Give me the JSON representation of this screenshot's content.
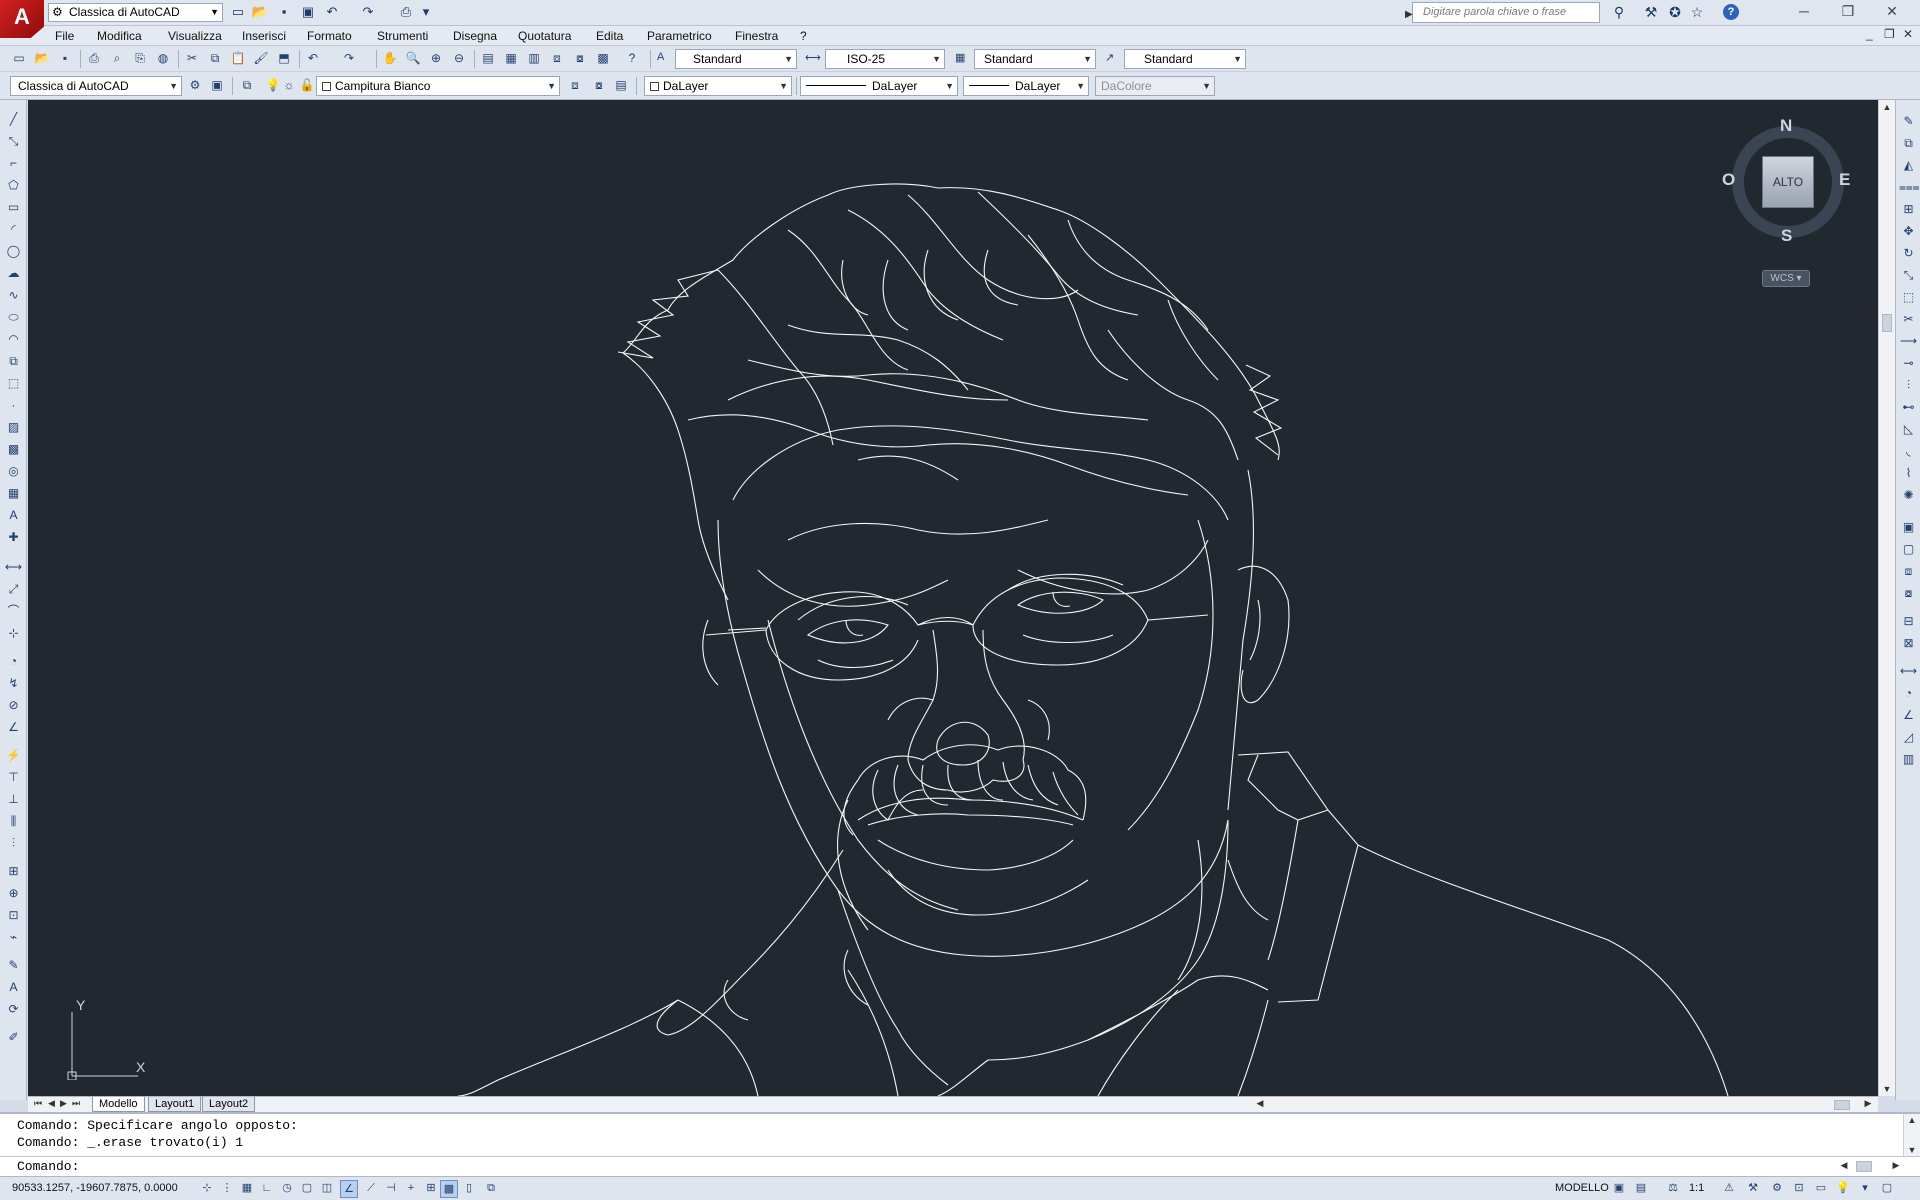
{
  "app": {
    "logo_letter": "A",
    "workspace": "Classica di AutoCAD",
    "search_placeholder": "Digitare parola chiave o frase",
    "help_label": "?"
  },
  "menu": [
    "File",
    "Modifica",
    "Visualizza",
    "Inserisci",
    "Formato",
    "Strumenti",
    "Disegna",
    "Quotatura",
    "Edita",
    "Parametrico",
    "Finestra",
    "?"
  ],
  "styles": {
    "text_style": "Standard",
    "dim_style": "ISO-25",
    "table_style": "Standard",
    "multileader_style": "Standard"
  },
  "layers": {
    "workspace": "Classica di AutoCAD",
    "current_layer": "Campitura Bianco",
    "color": "DaLayer",
    "linetype": "DaLayer",
    "lineweight": "DaLayer",
    "plot_style": "DaColore"
  },
  "viewcube": {
    "north": "N",
    "south": "S",
    "east": "E",
    "west": "O",
    "face": "ALTO",
    "wcs": "WCS"
  },
  "ucs": {
    "x": "X",
    "y": "Y"
  },
  "tabs": [
    "Modello",
    "Layout1",
    "Layout2"
  ],
  "command": {
    "history": [
      "Comando: Specificare angolo opposto:",
      "Comando: _.erase trovato(i) 1"
    ],
    "prompt": "Comando:"
  },
  "status": {
    "coordinates": "90533.1257, -19607.7875, 0.0000",
    "space": "MODELLO",
    "scale": "1:1"
  },
  "colors": {
    "canvas": "#212830",
    "linework": "#ffffff",
    "chrome": "#dfe5ee"
  }
}
